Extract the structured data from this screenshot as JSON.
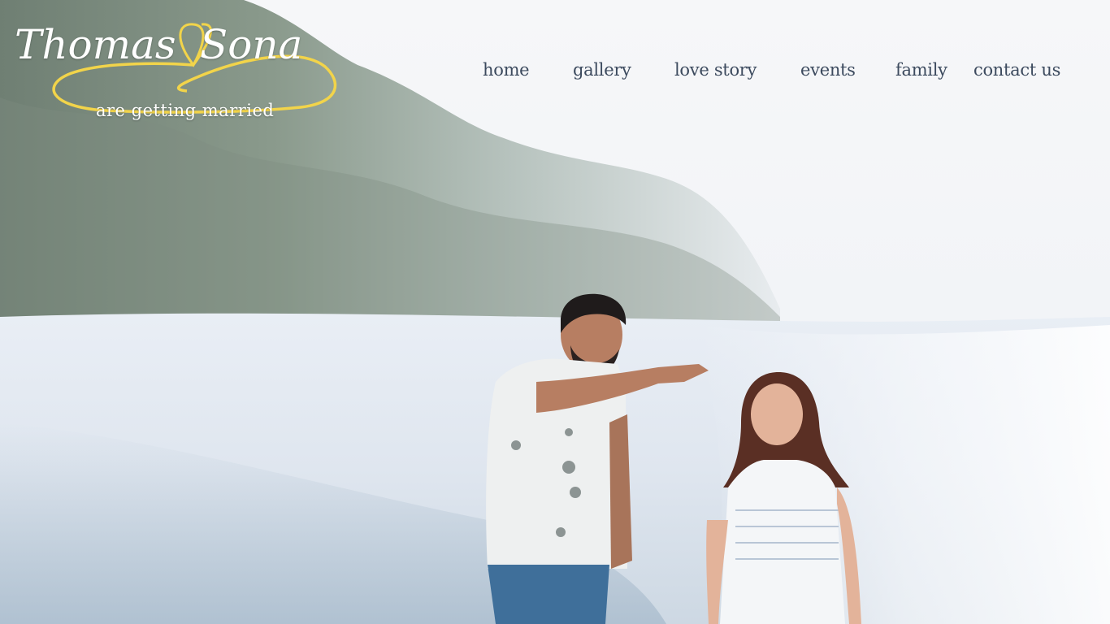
{
  "logo": {
    "name_first": "Thomas",
    "name_second": "Sona",
    "tagline": "are getting married",
    "heart_color": "#f2d44a"
  },
  "nav": {
    "items": [
      {
        "label": "home"
      },
      {
        "label": "gallery"
      },
      {
        "label": "love story"
      },
      {
        "label": "events"
      },
      {
        "label": "family"
      },
      {
        "label": "contact us"
      }
    ]
  },
  "colors": {
    "nav_text": "#3c4a5e",
    "logo_text": "#ffffff",
    "accent": "#f2d44a"
  }
}
